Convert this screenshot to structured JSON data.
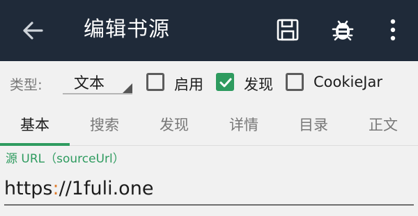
{
  "appbar": {
    "title": "编辑书源",
    "icons": [
      "back-arrow-icon",
      "save-icon",
      "bug-icon",
      "more-vert-icon"
    ],
    "background": "#1f2a39"
  },
  "options": {
    "type_label": "类型:",
    "type_value": "文本",
    "checkboxes": [
      {
        "label": "启用",
        "checked": false
      },
      {
        "label": "发现",
        "checked": true
      },
      {
        "label": "CookieJar",
        "checked": false
      }
    ]
  },
  "tabs": [
    {
      "label": "基本",
      "active": true
    },
    {
      "label": "搜索",
      "active": false
    },
    {
      "label": "发现",
      "active": false
    },
    {
      "label": "详情",
      "active": false
    },
    {
      "label": "目录",
      "active": false
    },
    {
      "label": "正文",
      "active": false
    }
  ],
  "field": {
    "label": "源 URL（sourceUrl）",
    "value_prefix": "https",
    "value_colon": ":",
    "value_suffix": "//1fuli.one"
  },
  "colors": {
    "accent": "#2e9b5f",
    "highlight": "#e07b2a"
  }
}
